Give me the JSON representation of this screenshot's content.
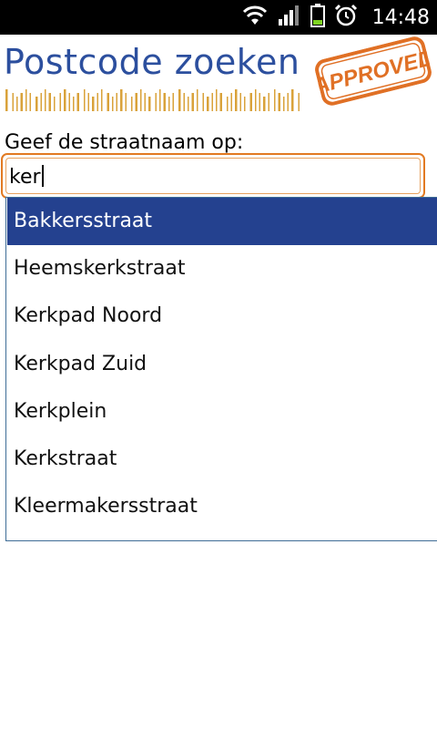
{
  "status_bar": {
    "time": "14:48",
    "icons": [
      "wifi-icon",
      "signal-icon",
      "battery-icon",
      "alarm-icon"
    ]
  },
  "header": {
    "logo_text": "Postcode zoeken",
    "stamp_text": "APPROVED",
    "colors": {
      "logo": "#2c4f9e",
      "stamp": "#e07025",
      "barcode": "#d9a23a"
    }
  },
  "form": {
    "label": "Geef de straatnaam op:",
    "input_value": "ker"
  },
  "suggestions": {
    "selected_index": 0,
    "items": [
      "Bakkersstraat",
      "Heemskerkstraat",
      "Kerkpad Noord",
      "Kerkpad Zuid",
      "Kerkplein",
      "Kerkstraat",
      "Kleermakersstraat"
    ],
    "colors": {
      "selected_bg": "#24418f",
      "border": "#3f6d96"
    }
  }
}
